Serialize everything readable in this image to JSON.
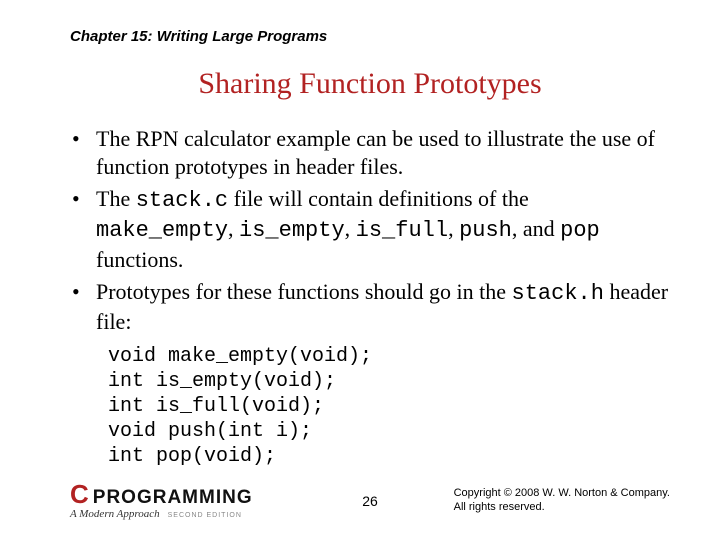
{
  "chapter": "Chapter 15: Writing Large Programs",
  "title": "Sharing Function Prototypes",
  "bullets": [
    {
      "pre": "The RPN calculator example can be used to illustrate the use of function prototypes in header files."
    },
    {
      "pre": "The ",
      "c1": "stack.c",
      "mid1": " file will contain definitions of the ",
      "c2": "make_empty",
      "mid2": ", ",
      "c3": "is_empty",
      "mid3": ", ",
      "c4": "is_full",
      "mid4": ", ",
      "c5": "push",
      "mid5": ", and ",
      "c6": "pop",
      "post": " functions."
    },
    {
      "pre": "Prototypes for these functions should go in the ",
      "c1": "stack.h",
      "post": " header file:"
    }
  ],
  "code": "void make_empty(void);\nint is_empty(void);\nint is_full(void);\nvoid push(int i);\nint pop(void);",
  "page": "26",
  "logo": {
    "c": "C",
    "word": "PROGRAMMING",
    "sub": "A Modern Approach",
    "ed": "SECOND EDITION"
  },
  "copyright": {
    "l1": "Copyright © 2008 W. W. Norton & Company.",
    "l2": "All rights reserved."
  }
}
